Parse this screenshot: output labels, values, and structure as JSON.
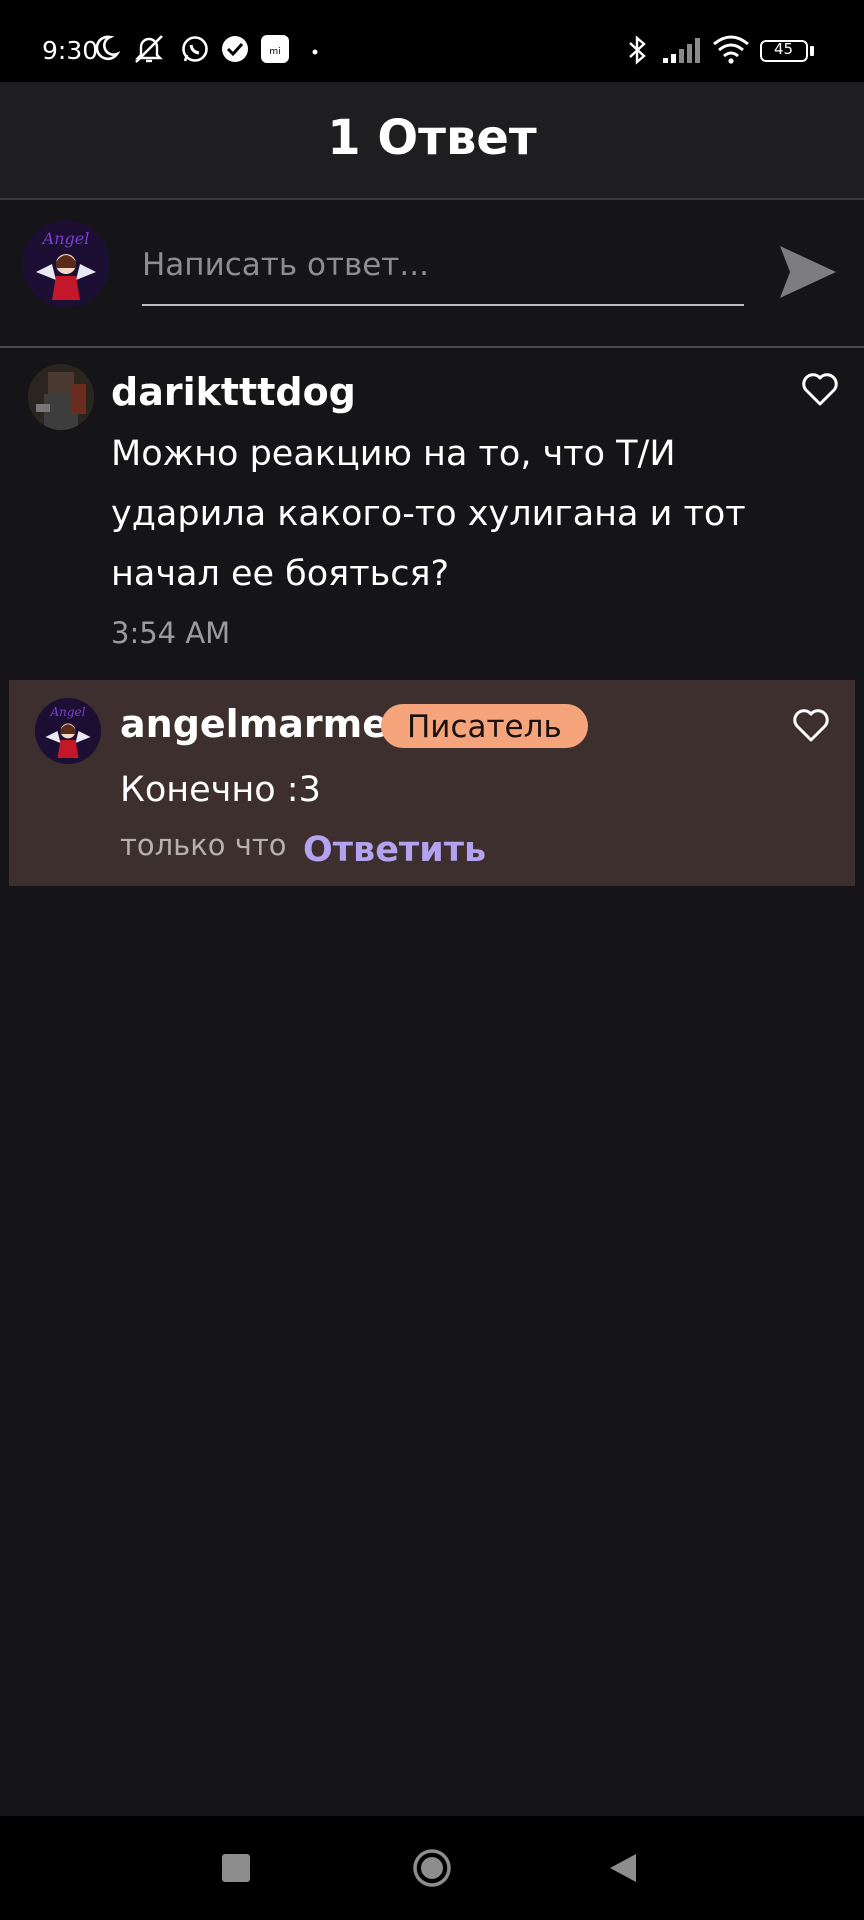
{
  "status_bar": {
    "time": "9:30",
    "battery": "45",
    "icons": [
      "moon-icon",
      "notifications-muted-icon",
      "whatsapp-icon",
      "check-icon",
      "mi-icon",
      "dot-icon",
      "bluetooth-icon",
      "signal-icon",
      "wifi-icon",
      "battery-icon"
    ]
  },
  "header": {
    "title": "1 Ответ"
  },
  "composer": {
    "placeholder": "Написать ответ...",
    "value": ""
  },
  "comment": {
    "username": "dariktttdog",
    "text": "Можно реакцию на то, что Т/И ударила какого-то хулигана и тот начал ее бояться?",
    "lines": [
      "Можно реакцию на то, что Т/И",
      "ударила какого-то хулигана и тот",
      "начал ее бояться?"
    ],
    "time": "3:54 AM"
  },
  "reply": {
    "username": "angelmarmer",
    "badge": "Писатель",
    "text": "Конечно :3",
    "time": "только что",
    "reply_label": "Ответить"
  },
  "colors": {
    "background": "#151417",
    "header": "#1e1e20",
    "reply_highlight": "#3c2f2d",
    "badge": "#f5a47c",
    "link": "#b3a2ef"
  }
}
